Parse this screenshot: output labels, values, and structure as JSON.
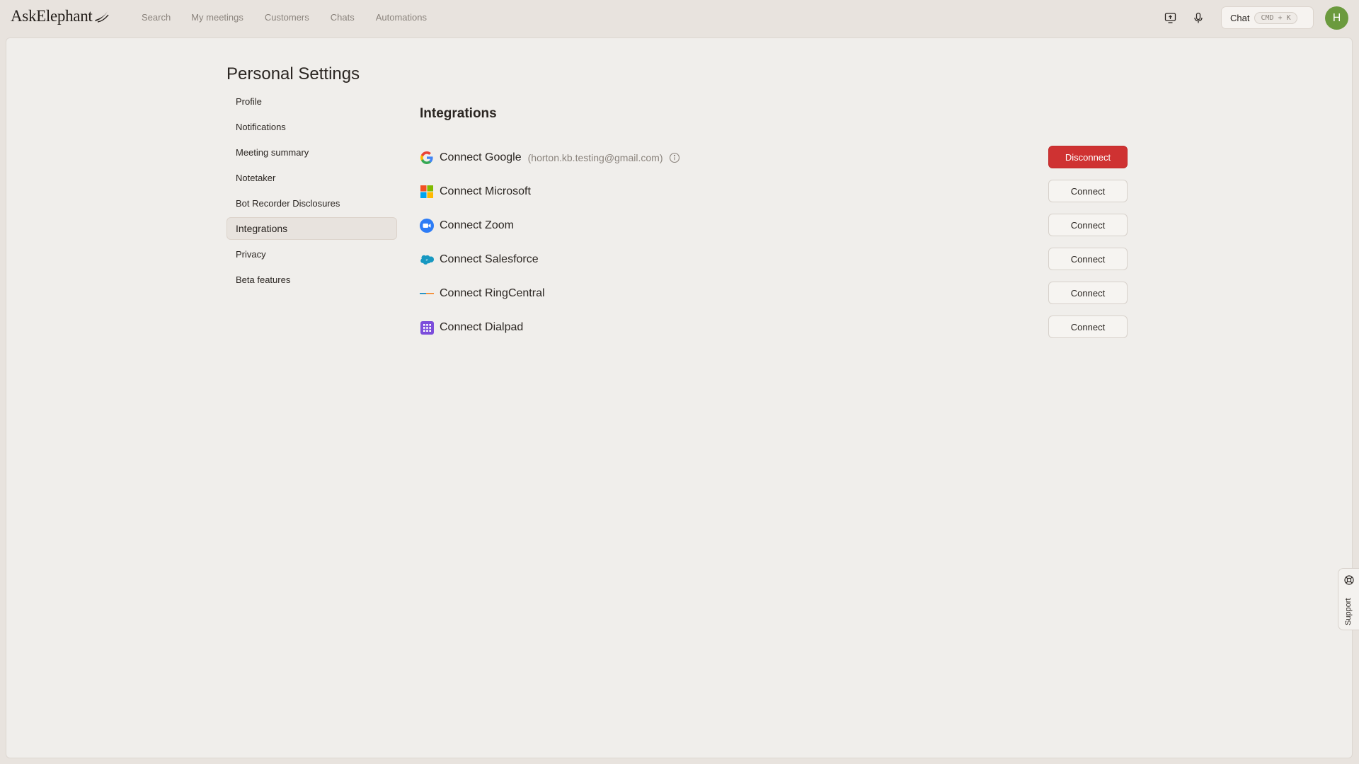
{
  "app": {
    "logo_text": "AskElephant"
  },
  "nav": {
    "items": [
      {
        "label": "Search"
      },
      {
        "label": "My meetings"
      },
      {
        "label": "Customers"
      },
      {
        "label": "Chats"
      },
      {
        "label": "Automations"
      }
    ]
  },
  "header": {
    "present_icon": "screen-share-icon",
    "mic_icon": "microphone-icon",
    "chat_label": "Chat",
    "chat_shortcut": "CMD + K",
    "avatar_initial": "H",
    "avatar_color": "#6b9a3e"
  },
  "page": {
    "title": "Personal Settings"
  },
  "sidebar": {
    "items": [
      {
        "label": "Profile",
        "active": false
      },
      {
        "label": "Notifications",
        "active": false
      },
      {
        "label": "Meeting summary",
        "active": false
      },
      {
        "label": "Notetaker",
        "active": false
      },
      {
        "label": "Bot Recorder Disclosures",
        "active": false
      },
      {
        "label": "Integrations",
        "active": true
      },
      {
        "label": "Privacy",
        "active": false
      },
      {
        "label": "Beta features",
        "active": false
      }
    ]
  },
  "integrations": {
    "title": "Integrations",
    "items": [
      {
        "name": "Connect Google",
        "icon": "google-icon",
        "account": "(horton.kb.testing@gmail.com)",
        "button": "Disconnect",
        "connected": true
      },
      {
        "name": "Connect Microsoft",
        "icon": "microsoft-icon",
        "button": "Connect",
        "connected": false
      },
      {
        "name": "Connect Zoom",
        "icon": "zoom-icon",
        "button": "Connect",
        "connected": false
      },
      {
        "name": "Connect Salesforce",
        "icon": "salesforce-icon",
        "button": "Connect",
        "connected": false
      },
      {
        "name": "Connect RingCentral",
        "icon": "ringcentral-icon",
        "button": "Connect",
        "connected": false
      },
      {
        "name": "Connect Dialpad",
        "icon": "dialpad-icon",
        "button": "Connect",
        "connected": false
      }
    ]
  },
  "support": {
    "label": "Support",
    "icon": "lifebuoy-icon"
  },
  "colors": {
    "danger": "#cf3232",
    "background": "#e8e3de",
    "panel": "#f0eeeb"
  }
}
